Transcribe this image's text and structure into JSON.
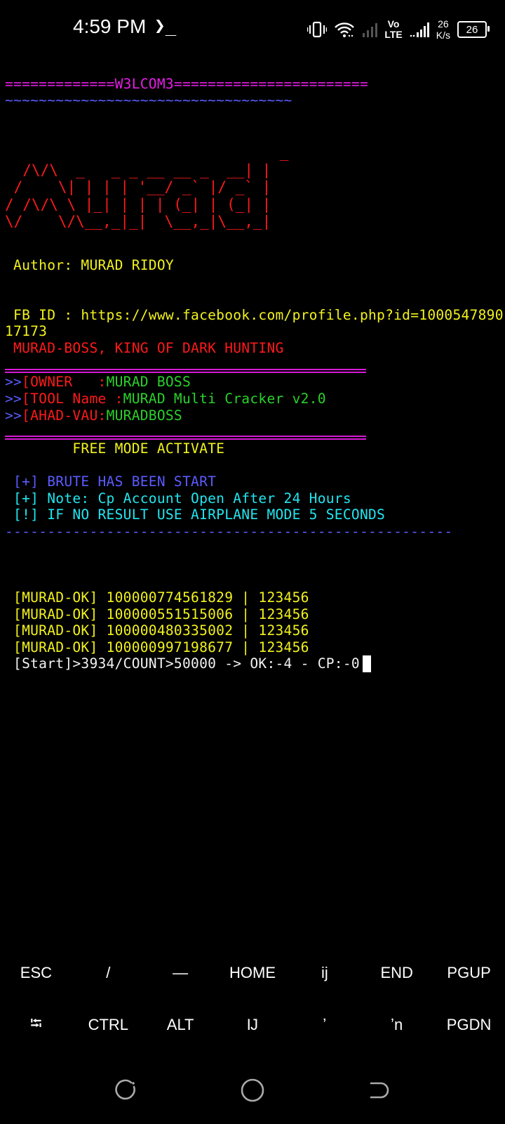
{
  "status_bar": {
    "time": "4:59 PM",
    "prompt_glyph": "❯_",
    "network_vo": "Vo",
    "network_lte": "LTE",
    "speed_value": "26",
    "speed_unit": "K/s",
    "battery": "26",
    "icons": [
      "vibrate-icon",
      "wifi-icon",
      "signal-icon",
      "signal-icon"
    ]
  },
  "terminal": {
    "welcome_left": "=============",
    "welcome_word": "W3LCOM3",
    "welcome_right": "=======================",
    "tilde_line": "~~~~~~~~~~~~~~~~~~~~~~~~~~~~~~~~~~",
    "banner_art": "                               _\n  /\\/\\  _   _ _ __ __ _  __| |\n /    \\| | | | '__/ _` |/ _` |\n/ /\\/\\ \\ |_| | | | (_| | (_| |\n\\/    \\/\\__,_|_|  \\__,_|\\__,_|",
    "author": " Author: MURAD RIDOY",
    "fb_line1": " FB ID : https://www.facebook.com/profile.php?id=1000547890",
    "fb_line2": "17173",
    "tagline": " MURAD-BOSS, KING OF DARK HUNTING",
    "info": [
      {
        "prefix": ">>",
        "bracket": "[",
        "key": "OWNER   ",
        "sep": ":",
        "value": "MURAD BOSS"
      },
      {
        "prefix": ">>",
        "bracket": "[",
        "key": "TOOL Name ",
        "sep": ":",
        "value": "MURAD Multi Cracker v2.0"
      },
      {
        "prefix": ">>",
        "bracket": "[",
        "key": "AHAD-VAU",
        "sep": ":",
        "value": "MURADBOSS"
      }
    ],
    "free_mode": "        FREE MODE ACTIVATE",
    "notices": [
      " [+] BRUTE HAS BEEN START",
      " [+] Note: Cp Account Open After 24 Hours",
      " [!] IF NO RESULT USE AIRPLANE MODE 5 SECONDS"
    ],
    "dash_line": "-----------------------------------------------------",
    "results": [
      " [MURAD-OK] 100000774561829 | 123456",
      " [MURAD-OK] 100000551515006 | 123456",
      " [MURAD-OK] 100000480335002 | 123456",
      " [MURAD-OK] 100000997198677 | 123456"
    ],
    "progress_line": " [Start]>3934/COUNT>50000 -> OK:-4 - CP:-0"
  },
  "extra_keys": {
    "row1": [
      "ESC",
      "/",
      "—",
      "HOME",
      "ij",
      "END",
      "PGUP"
    ],
    "row2": [
      "⭾",
      "CTRL",
      "ALT",
      "Ĳ",
      "ʼ",
      "ʼn",
      "PGDN"
    ]
  },
  "nav_icons": [
    "recent-apps-icon",
    "home-icon",
    "back-icon"
  ]
}
